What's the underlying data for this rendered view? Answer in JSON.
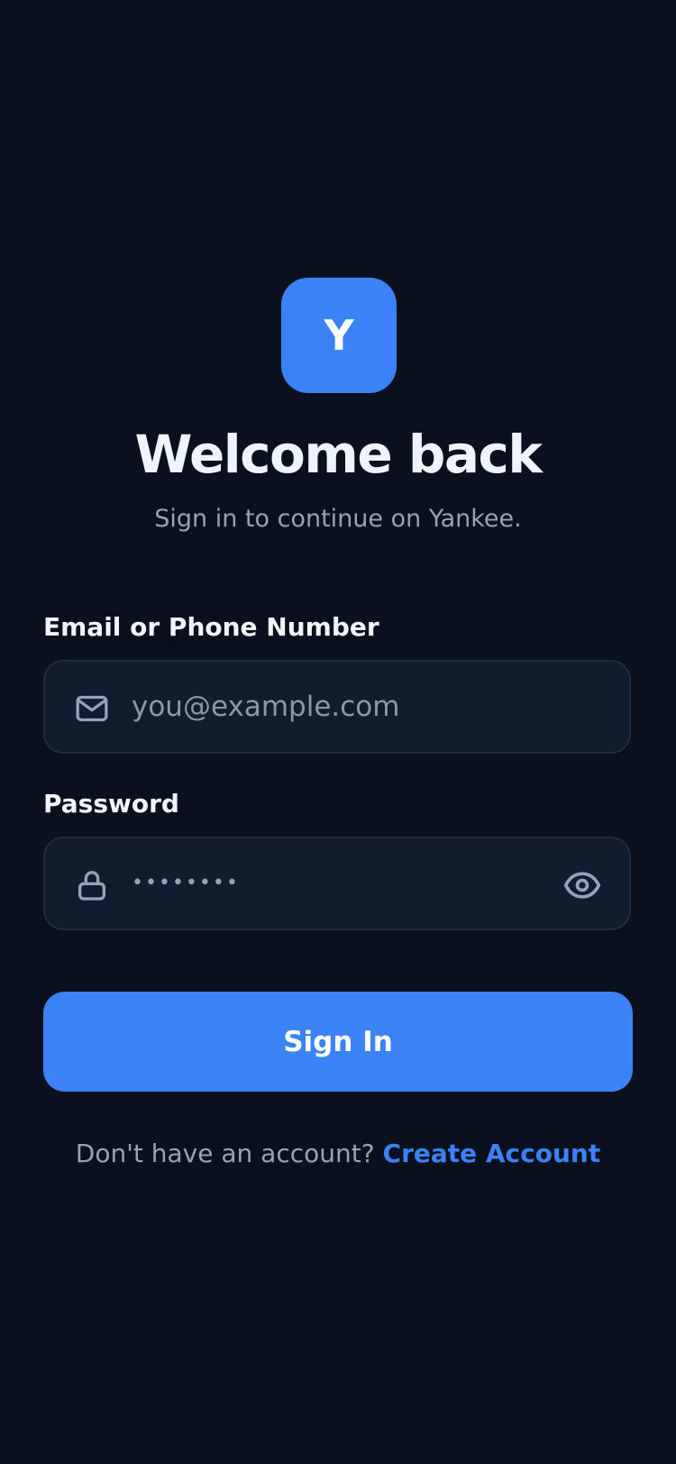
{
  "brand": {
    "logo_letter": "Y",
    "accent_color": "#3b82f6"
  },
  "header": {
    "title": "Welcome back",
    "subtitle": "Sign in to continue on Yankee."
  },
  "form": {
    "email": {
      "label": "Email or Phone Number",
      "placeholder": "you@example.com",
      "value": "",
      "icon": "mail-icon"
    },
    "password": {
      "label": "Password",
      "masked_value": "••••••••",
      "icon": "lock-icon",
      "toggle_icon": "eye-icon"
    },
    "submit_label": "Sign In"
  },
  "footer": {
    "prompt": "Don't have an account?",
    "link_label": "Create Account"
  }
}
